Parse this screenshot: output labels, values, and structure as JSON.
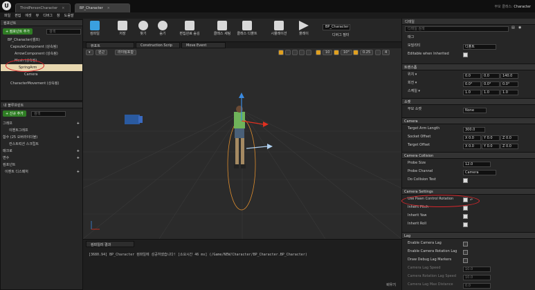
{
  "tabs": [
    {
      "label": "ThirdPersonCharacter"
    },
    {
      "label": "BP_Character"
    }
  ],
  "brand": {
    "product": "부모 클래스:",
    "name": "Character"
  },
  "menu": [
    "파일",
    "편집",
    "에셋",
    "뷰",
    "디버그",
    "창",
    "도움말"
  ],
  "components": {
    "header": "컴포넌트",
    "add_label": "+ 컴포넌트 추가",
    "search_placeholder": "검색",
    "tree": [
      "BP_Character(셀프)",
      "CapsuleComponent (상속됨)",
      "ArrowComponent (상속됨)",
      "Mesh (상속됨)",
      "SpringArm",
      "Camera",
      "CharacterMovement (상속됨)"
    ]
  },
  "blueprint": {
    "header": "내 블루프린트",
    "add_label": "+ 신규 추가",
    "search_placeholder": "검색",
    "rows": [
      "그래프",
      "이벤트그래프",
      "함수 (25 오버라이더블)",
      "컨스트럭션 스크립트",
      "매크로",
      "변수",
      "컴포넌트",
      "이벤트 디스패처"
    ]
  },
  "toolbar": [
    {
      "label": "컴파일",
      "icon": "compile-icon"
    },
    {
      "label": "저장",
      "icon": "save-icon"
    },
    {
      "label": "찾기",
      "icon": "find-icon"
    },
    {
      "label": "숨기",
      "icon": "hide-icon"
    },
    {
      "label": "편집완료 숨김",
      "icon": "hide-unrelated-icon"
    },
    {
      "label": "클래스 세팅",
      "icon": "class-settings-icon"
    },
    {
      "label": "클래스 디폴트",
      "icon": "class-defaults-icon"
    },
    {
      "label": "시뮬레이션",
      "icon": "simulation-icon"
    },
    {
      "label": "플레이",
      "icon": "play-icon"
    }
  ],
  "debug": {
    "selected": "BP_Character",
    "filter_label": "디버그 필터"
  },
  "view_tabs": [
    "뷰포트",
    "Construction Scrip",
    "Move Event"
  ],
  "viewport": {
    "perspective": "원근",
    "lit": "라이팅포함",
    "grid": "10",
    "angle": "10°",
    "scale": "0.25",
    "cam": "4"
  },
  "log": {
    "header": "컴파일러 결과",
    "message": "[3680.94] BP_Character 컴파일에 성공하였습니다! [소요시간 46 ms] (/Game/NEW/Character/BP_Character.BP_Character)",
    "clear_label": "비우기"
  },
  "details": {
    "header": "디테일",
    "search_placeholder": "디테일 검색",
    "tags": "태그",
    "mobility_label": "모빌리티",
    "mobility_value": "디폴트",
    "editable_label": "Editable when Inherited",
    "transform": {
      "title": "트랜스폼",
      "location_label": "위치 ▾",
      "location": [
        "0.0",
        "0.0",
        "140.0"
      ],
      "rotation_label": "회전 ▾",
      "rotation": [
        "0.0°",
        "0.0°",
        "0.0°"
      ],
      "scale_label": "스케일 ▾",
      "scale": [
        "1.0",
        "1.0",
        "1.0"
      ]
    },
    "socket": {
      "title": "소켓",
      "parent_label": "부모 소켓",
      "parent_value": "None"
    },
    "camera": {
      "title": "Camera",
      "arm_label": "Target Arm Length",
      "arm": "300.0",
      "socket_label": "Socket Offset",
      "socket": [
        "X 0.0",
        "Y 0.0",
        "Z 0.0"
      ],
      "target_label": "Target Offset",
      "target": [
        "X 0.0",
        "Y 0.0",
        "Z 0.0"
      ]
    },
    "collision": {
      "title": "Camera Collision",
      "probe_size_label": "Probe Size",
      "probe_size": "12.0",
      "probe_channel_label": "Probe Channel",
      "probe_channel": "Camera",
      "do_test_label": "Do Collision Test"
    },
    "settings": {
      "title": "Camera Settings",
      "pawn_label": "Use Pawn Control Rotation",
      "pitch_label": "Inherit Pitch",
      "yaw_label": "Inherit Yaw",
      "roll_label": "Inherit Roll"
    },
    "lag": {
      "title": "Lag",
      "enable_label": "Enable Camera Lag",
      "rot_label": "Enable Camera Rotation Lag",
      "markers_label": "Draw Debug Lag Markers",
      "speed_label": "Camera Lag Speed",
      "speed": "10.0",
      "rot_speed_label": "Camera Rotation Lag Speed",
      "rot_speed": "10.0",
      "max_label": "Camera Lag Max Distance",
      "max": "0.0"
    }
  }
}
